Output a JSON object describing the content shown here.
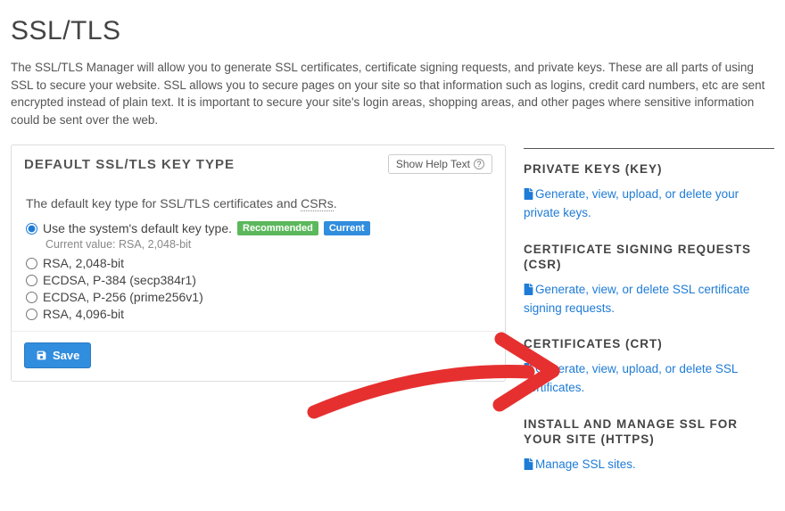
{
  "page": {
    "title": "SSL/TLS",
    "description": "The SSL/TLS Manager will allow you to generate SSL certificates, certificate signing requests, and private keys. These are all parts of using SSL to secure your website. SSL allows you to secure pages on your site so that information such as logins, credit card numbers, etc are sent encrypted instead of plain text. It is important to secure your site's login areas, shopping areas, and other pages where sensitive information could be sent over the web."
  },
  "panel": {
    "heading": "DEFAULT SSL/TLS KEY TYPE",
    "help_btn": "Show Help Text",
    "intro_pre": "The default key type for SSL/TLS certificates and ",
    "intro_abbr": "CSRs",
    "intro_post": ".",
    "options": [
      {
        "label": "Use the system's default key type.",
        "recommended": "Recommended",
        "current": "Current",
        "note": "Current value: RSA, 2,048-bit",
        "checked": true
      },
      {
        "label": "RSA, 2,048-bit"
      },
      {
        "label": "ECDSA, P-384 (secp384r1)"
      },
      {
        "label": "ECDSA, P-256 (prime256v1)"
      },
      {
        "label": "RSA, 4,096-bit"
      }
    ],
    "save_label": "Save"
  },
  "sidebar": {
    "sections": [
      {
        "heading": "PRIVATE KEYS (KEY)",
        "link": "Generate, view, upload, or delete your private keys."
      },
      {
        "heading": "CERTIFICATE SIGNING REQUESTS (CSR)",
        "link": "Generate, view, or delete SSL certificate signing requests."
      },
      {
        "heading": "CERTIFICATES (CRT)",
        "link": "Generate, view, upload, or delete SSL certificates."
      },
      {
        "heading": "INSTALL AND MANAGE SSL FOR YOUR SITE (HTTPS)",
        "link": "Manage SSL sites."
      }
    ]
  }
}
